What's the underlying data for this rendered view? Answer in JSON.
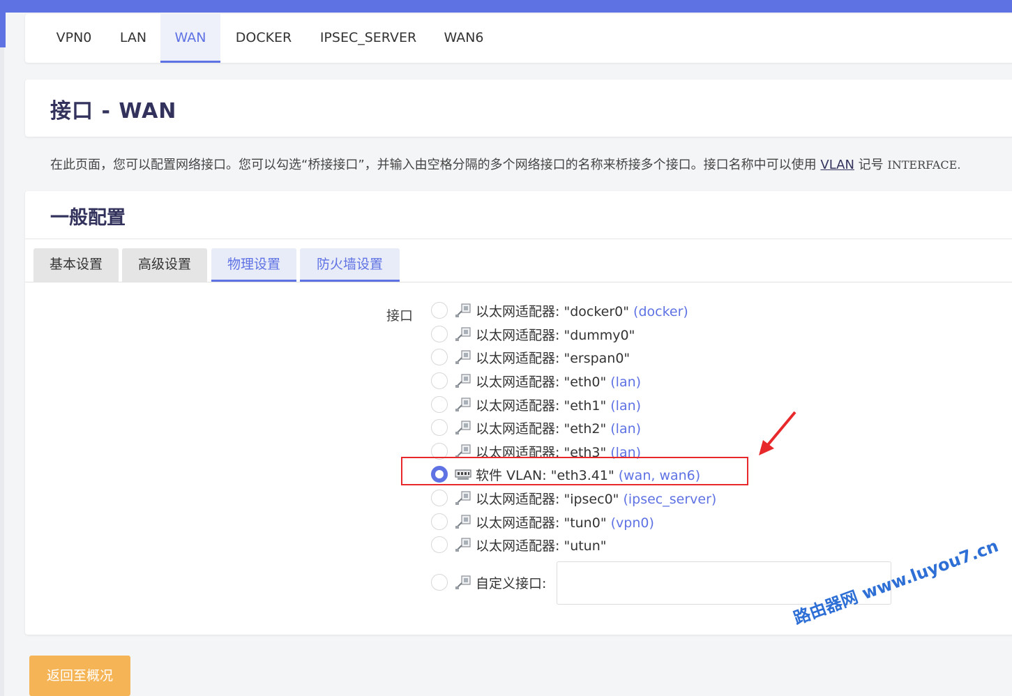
{
  "tabs": [
    "VPN0",
    "LAN",
    "WAN",
    "DOCKER",
    "IPSEC_SERVER",
    "WAN6"
  ],
  "page_title": "接口 - WAN",
  "description": {
    "text": "在此页面，您可以配置网络接口。您可以勾选“桥接接口”，并输入由空格分隔的多个网络接口的名称来桥接多个接口。接口名称中可以使用",
    "vlan_link": "VLAN",
    "text_after": "记号",
    "mono": "INTERFACE."
  },
  "section_title": "一般配置",
  "subtabs": [
    "基本设置",
    "高级设置",
    "物理设置",
    "防火墙设置"
  ],
  "interface_field": {
    "label": "接口",
    "options": [
      {
        "prefix": "以太网适配器: ",
        "name": "\"docker0\"",
        "zone": "(docker)"
      },
      {
        "prefix": "以太网适配器: ",
        "name": "\"dummy0\"",
        "zone": ""
      },
      {
        "prefix": "以太网适配器: ",
        "name": "\"erspan0\"",
        "zone": ""
      },
      {
        "prefix": "以太网适配器: ",
        "name": "\"eth0\"",
        "zone": "(lan)"
      },
      {
        "prefix": "以太网适配器: ",
        "name": "\"eth1\"",
        "zone": "(lan)"
      },
      {
        "prefix": "以太网适配器: ",
        "name": "\"eth2\"",
        "zone": "(lan)"
      },
      {
        "prefix": "以太网适配器: ",
        "name": "\"eth3\"",
        "zone": "(lan)"
      },
      {
        "prefix": "软件 VLAN: ",
        "name": "\"eth3.41\"",
        "zone": "(wan, wan6)"
      },
      {
        "prefix": "以太网适配器: ",
        "name": "\"ipsec0\"",
        "zone": "(ipsec_server)"
      },
      {
        "prefix": "以太网适配器: ",
        "name": "\"tun0\"",
        "zone": "(vpn0)"
      },
      {
        "prefix": "以太网适配器: ",
        "name": "\"utun\"",
        "zone": ""
      }
    ],
    "selected": "\"eth3.41\"",
    "custom_label": "自定义接口:",
    "custom_value": ""
  },
  "back_button": "返回至概况",
  "watermark": "路由器网 www.luyou7.cn",
  "colors": {
    "accent": "#5e72e4",
    "button": "#f5b556",
    "highlight": "#e8292c",
    "watermark": "#2e6fd6"
  }
}
